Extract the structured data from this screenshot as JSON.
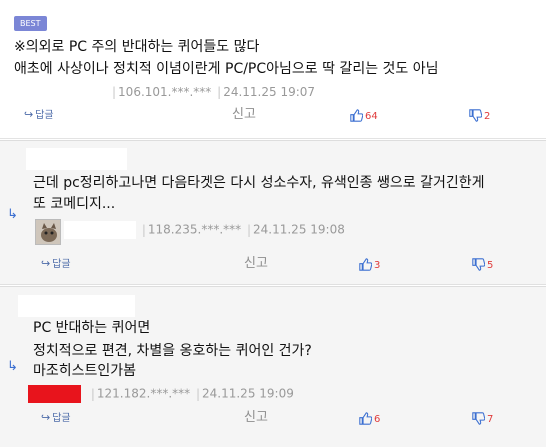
{
  "best_comment": {
    "badge": "BEST",
    "lines": [
      "※의외로 PC 주의 반대하는 퀴어들도 많다",
      "애초에 사상이나 정치적 이념이란게 PC/PC아님으로 딱 갈리는 것도 아님"
    ],
    "meta": {
      "ip": "106.101.***.***",
      "time": "24.11.25 19:07"
    },
    "reply_label": "답글",
    "report_label": "신고",
    "upvotes": "64",
    "downvotes": "2"
  },
  "replies": [
    {
      "lines": [
        "근데 pc정리하고나면 다음타겟은 다시 성소수자, 유색인종 쌩으로 갈거긴한게",
        "또 코메디지..."
      ],
      "meta": {
        "ip": "118.235.***.***",
        "time": "24.11.25 19:08"
      },
      "reply_label": "답글",
      "report_label": "신고",
      "upvotes": "3",
      "downvotes": "5"
    },
    {
      "lines": [
        "PC 반대하는 퀴어면",
        "정치적으로 편견, 차별을 옹호하는 퀴어인 건가?",
        "마조히스트인가봄"
      ],
      "meta": {
        "ip": "121.182.***.***",
        "time": "24.11.25 19:09"
      },
      "reply_label": "답글",
      "report_label": "신고",
      "upvotes": "6",
      "downvotes": "7"
    }
  ],
  "colors": {
    "badge": "#7b86d6",
    "link": "#4b6aa8",
    "vote_icon": "#3b6fd1",
    "vote_count": "#e03c3c",
    "reply_bg": "#f5f5f5",
    "nick_red": "#e8141c"
  },
  "icons": {
    "reply": "reply-arrow-icon",
    "upvote": "thumbs-up-icon",
    "downvote": "thumbs-down-icon",
    "sub_reply": "sub-reply-arrow-icon"
  }
}
